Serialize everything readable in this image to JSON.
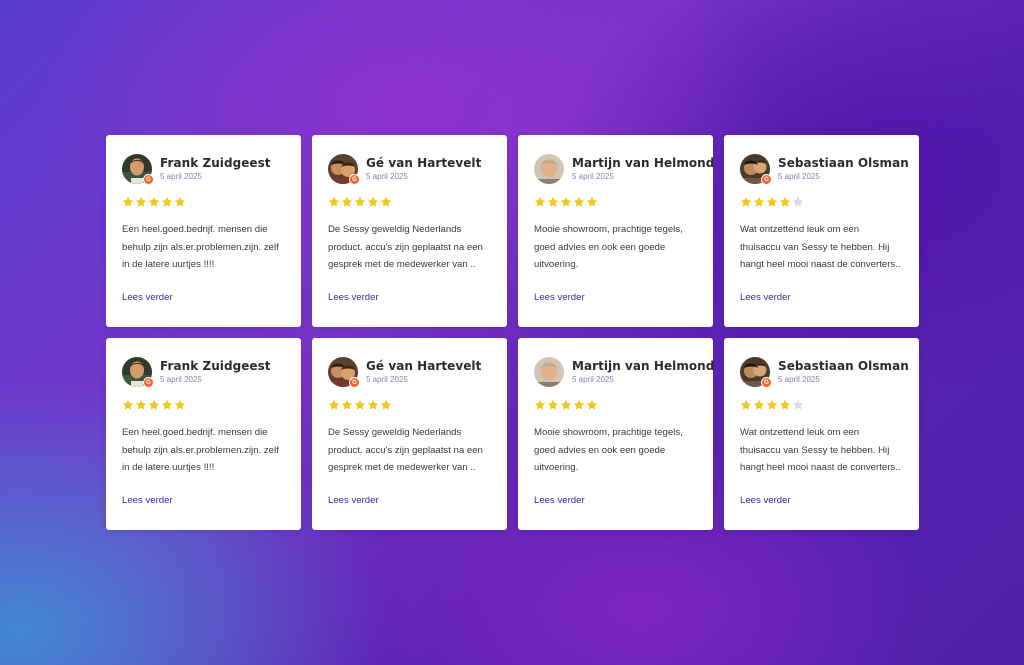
{
  "reviews": [
    {
      "name": "Frank Zuidgeest",
      "date": "5 april 2025",
      "rating": 5,
      "lines": [
        "Een heel.goed.bedrijf. mensen die",
        "behulp zijn als.er.problemen.zijn. zelf",
        "in de latere uurtjes !!!!"
      ],
      "more": "Lees verder",
      "avatar": "frank"
    },
    {
      "name": "Gé van Hartevelt",
      "date": "5 april 2025",
      "rating": 5,
      "lines": [
        "De Sessy geweldig Nederlands",
        "product. accu's zijn geplaatst na een",
        "gesprek met de medewerker van .."
      ],
      "more": "Lees verder",
      "avatar": "ge"
    },
    {
      "name": "Martijn van Helmond",
      "date": "5 april 2025",
      "rating": 5,
      "lines": [
        "Mooie showroom, prachtige tegels,",
        "goed advies en ook een goede",
        "uitvoering."
      ],
      "more": "Lees verder",
      "avatar": "martijn"
    },
    {
      "name": "Sebastiaan Olsman",
      "date": "5 april 2025",
      "rating": 4,
      "lines": [
        "Wat ontzettend leuk om een",
        "thuisaccu van Sessy te hebben. Hij",
        "hangt heel mooi naast de converters.."
      ],
      "more": "Lees verder",
      "avatar": "sebastiaan"
    },
    {
      "name": "Frank Zuidgeest",
      "date": "5 april 2025",
      "rating": 5,
      "lines": [
        "Een heel.goed.bedrijf. mensen die",
        "behulp zijn als.er.problemen.zijn. zelf",
        "in de latere uurtjes !!!!"
      ],
      "more": "Lees verder",
      "avatar": "frank"
    },
    {
      "name": "Gé van Hartevelt",
      "date": "5 april 2025",
      "rating": 5,
      "lines": [
        "De Sessy geweldig Nederlands",
        "product. accu's zijn geplaatst na een",
        "gesprek met de medewerker van .."
      ],
      "more": "Lees verder",
      "avatar": "ge"
    },
    {
      "name": "Martijn van Helmond",
      "date": "5 april 2025",
      "rating": 5,
      "lines": [
        "Mooie showroom, prachtige tegels,",
        "goed advies en ook een goede",
        "uitvoering."
      ],
      "more": "Lees verder",
      "avatar": "martijn"
    },
    {
      "name": "Sebastiaan Olsman",
      "date": "5 april 2025",
      "rating": 4,
      "lines": [
        "Wat ontzettend leuk om een",
        "thuisaccu van Sessy te hebben. Hij",
        "hangt heel mooi naast de converters.."
      ],
      "more": "Lees verder",
      "avatar": "sebastiaan"
    }
  ],
  "colors": {
    "star_filled": "#f5c518",
    "star_empty": "#d9d9e0",
    "link": "#3b2aa8",
    "badge": "#f0652a"
  },
  "icons": {
    "star": "star-icon",
    "badge": "google-badge-icon",
    "avatar": "user-photo"
  }
}
